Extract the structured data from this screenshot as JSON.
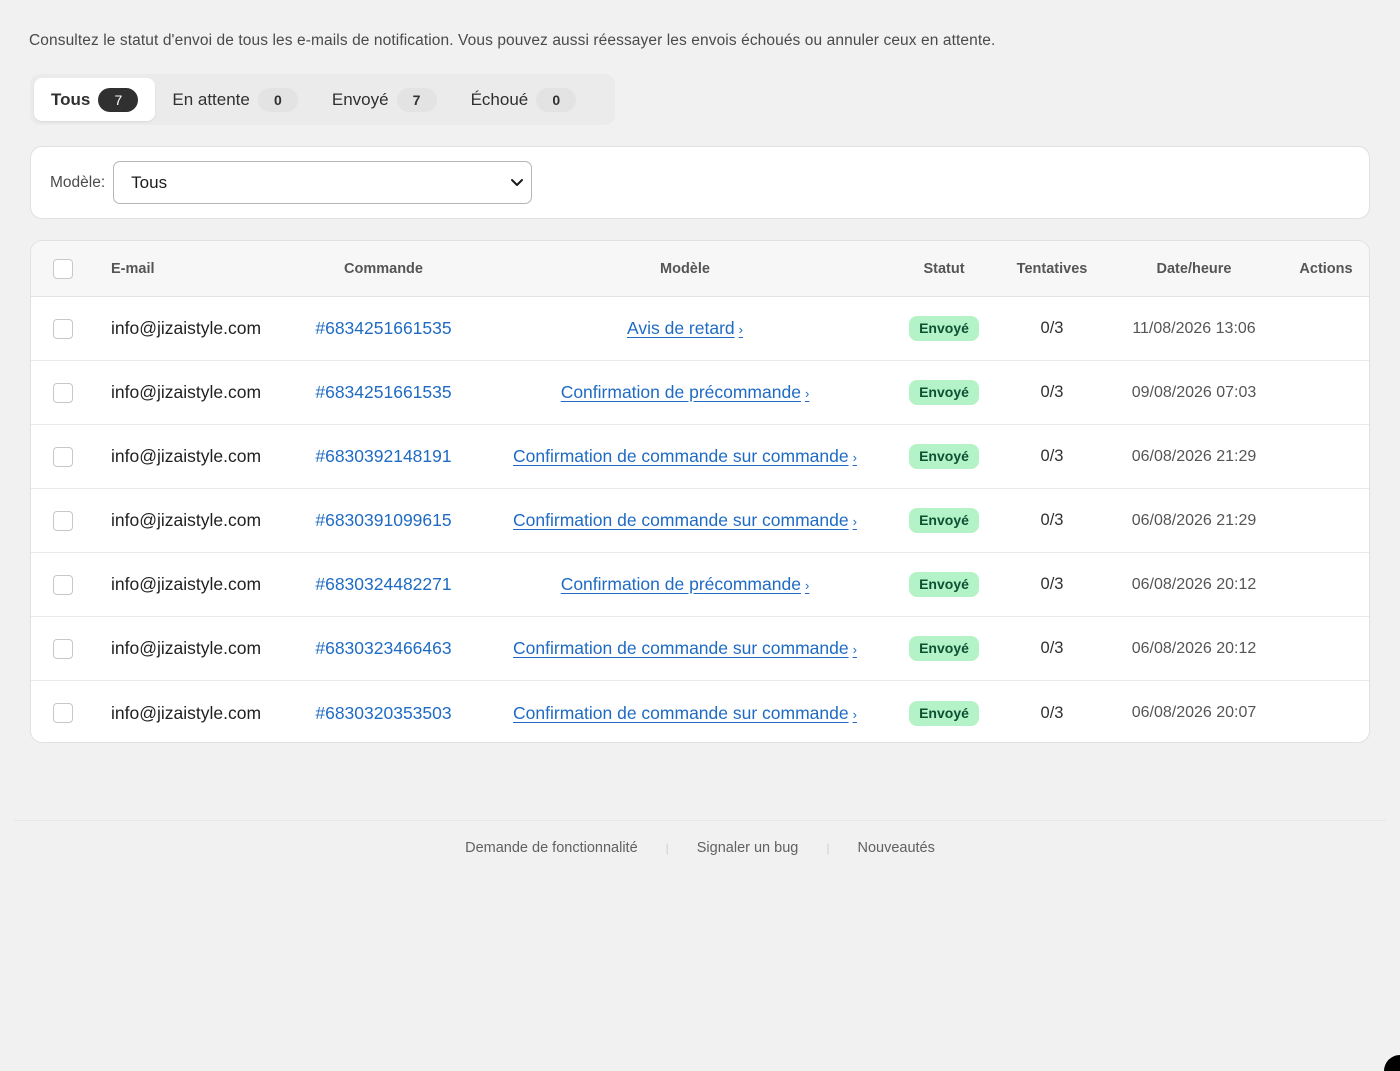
{
  "intro": "Consultez le statut d'envoi de tous les e-mails de notification. Vous pouvez aussi réessayer les envois échoués ou annuler ceux en attente.",
  "tabs": [
    {
      "label": "Tous",
      "count": "7"
    },
    {
      "label": "En attente",
      "count": "0"
    },
    {
      "label": "Envoyé",
      "count": "7"
    },
    {
      "label": "Échoué",
      "count": "0"
    }
  ],
  "filter": {
    "label": "Modèle:",
    "value": "Tous"
  },
  "table": {
    "headers": {
      "email": "E-mail",
      "order": "Commande",
      "model": "Modèle",
      "status": "Statut",
      "tries": "Tentatives",
      "date": "Date/heure",
      "actions": "Actions"
    },
    "rows": [
      {
        "email": "info@jizaistyle.com",
        "order": "#6834251661535",
        "model": "Avis de retard",
        "status": "Envoyé",
        "tries": "0/3",
        "date": "11/08/2026 13:06"
      },
      {
        "email": "info@jizaistyle.com",
        "order": "#6834251661535",
        "model": "Confirmation de précommande",
        "status": "Envoyé",
        "tries": "0/3",
        "date": "09/08/2026 07:03"
      },
      {
        "email": "info@jizaistyle.com",
        "order": "#6830392148191",
        "model": "Confirmation de commande sur commande",
        "status": "Envoyé",
        "tries": "0/3",
        "date": "06/08/2026 21:29"
      },
      {
        "email": "info@jizaistyle.com",
        "order": "#6830391099615",
        "model": "Confirmation de commande sur commande",
        "status": "Envoyé",
        "tries": "0/3",
        "date": "06/08/2026 21:29"
      },
      {
        "email": "info@jizaistyle.com",
        "order": "#6830324482271",
        "model": "Confirmation de précommande",
        "status": "Envoyé",
        "tries": "0/3",
        "date": "06/08/2026 20:12"
      },
      {
        "email": "info@jizaistyle.com",
        "order": "#6830323466463",
        "model": "Confirmation de commande sur commande",
        "status": "Envoyé",
        "tries": "0/3",
        "date": "06/08/2026 20:12"
      },
      {
        "email": "info@jizaistyle.com",
        "order": "#6830320353503",
        "model": "Confirmation de commande sur commande",
        "status": "Envoyé",
        "tries": "0/3",
        "date": "06/08/2026 20:07"
      }
    ]
  },
  "footer": {
    "links": [
      "Demande de fonctionnalité",
      "Signaler un bug",
      "Nouveautés"
    ]
  },
  "colors": {
    "background": "#f1f1f1",
    "link": "#1f6bc4",
    "badge_bg": "#b4f2c7",
    "badge_text": "#0c5132",
    "active_count_bg": "#303030"
  }
}
